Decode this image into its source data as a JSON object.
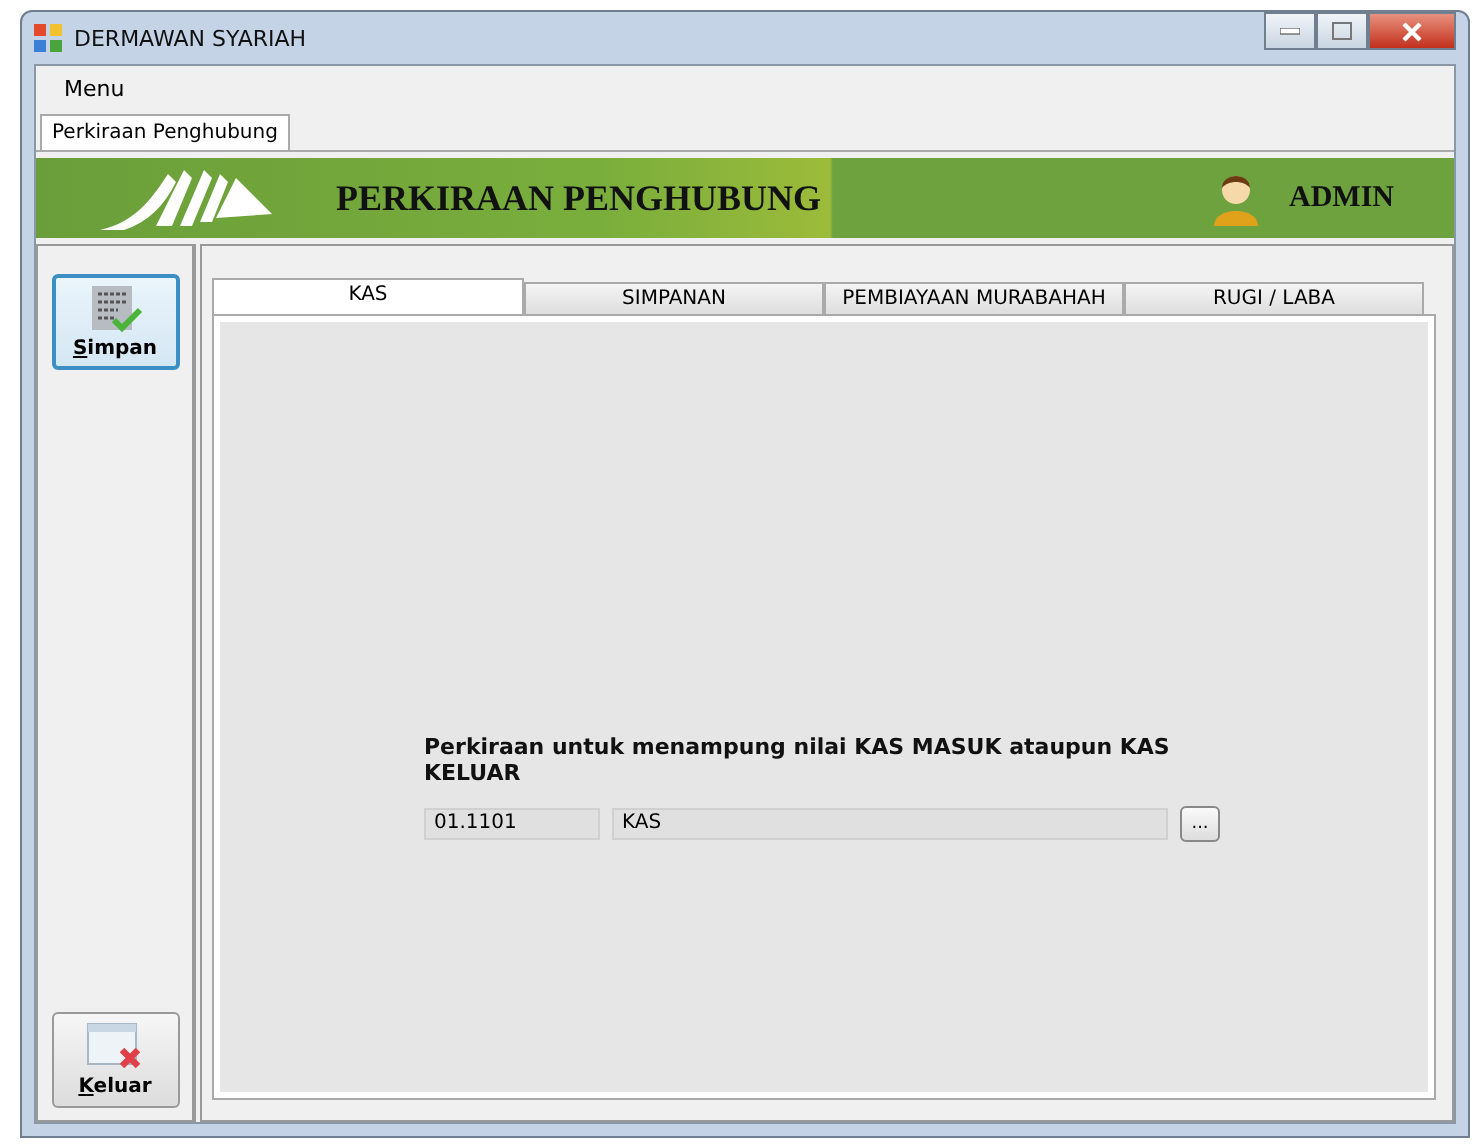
{
  "window": {
    "title": "DERMAWAN SYARIAH"
  },
  "menu": [
    "Menu"
  ],
  "document_tabs": [
    {
      "label": "Perkiraan Penghubung",
      "selected": true
    }
  ],
  "banner": {
    "title": "PERKIRAAN PENGHUBUNG",
    "user": "ADMIN"
  },
  "side_buttons": [
    {
      "kind": "save",
      "label": "Simpan"
    },
    {
      "kind": "exit",
      "label": "Keluar"
    }
  ],
  "tabs": [
    {
      "label": "KAS",
      "selected": true
    },
    {
      "label": "SIMPANAN",
      "selected": false
    },
    {
      "label": "PEMBIAYAAN MURABAHAH",
      "selected": false
    },
    {
      "label": "RUGI / LABA",
      "selected": false
    }
  ],
  "form": {
    "caption": "Perkiraan untuk menampung nilai KAS MASUK ataupun KAS KELUAR",
    "code": "01.1101",
    "name": "KAS",
    "browse_button": "..."
  }
}
